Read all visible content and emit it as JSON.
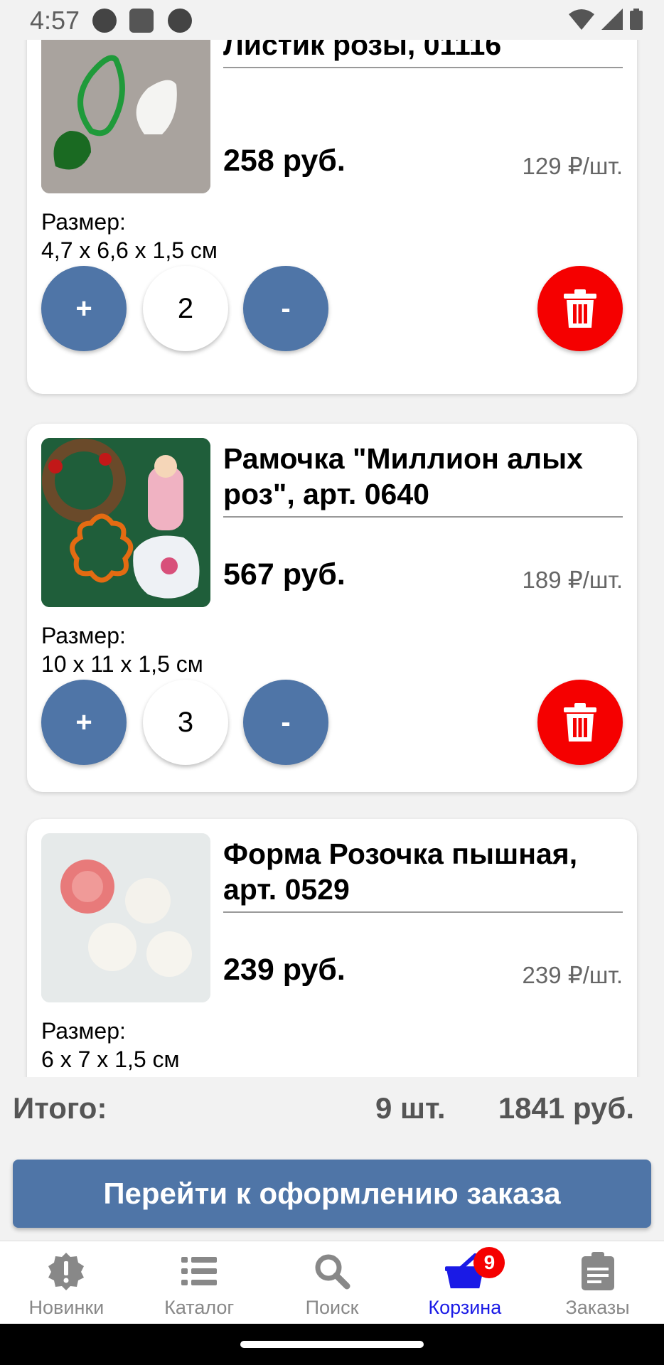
{
  "status_bar": {
    "time": "4:57"
  },
  "cart_items": [
    {
      "title": "Листик розы, 01116",
      "price": "258 руб.",
      "unit_price": "129 ₽/шт.",
      "size_label": "Размер:",
      "size": "4,7 x 6,6 x 1,5 см",
      "quantity": "2"
    },
    {
      "title": "Рамочка \"Миллион алых роз\", арт. 0640",
      "price": "567 руб.",
      "unit_price": "189 ₽/шт.",
      "size_label": "Размер:",
      "size": "10 x 11 x 1,5 см",
      "quantity": "3"
    },
    {
      "title": "Форма Розочка пышная, арт. 0529",
      "price": "239 руб.",
      "unit_price": "239 ₽/шт.",
      "size_label": "Размер:",
      "size": "6 x 7 x 1,5 см",
      "quantity": ""
    }
  ],
  "controls": {
    "plus": "+",
    "minus": "-"
  },
  "total": {
    "label": "Итого:",
    "count": "9 шт.",
    "sum": "1841 руб."
  },
  "checkout_label": "Перейти к оформлению заказа",
  "bottom_nav": {
    "items": [
      {
        "label": "Новинки",
        "icon": "alert-badge-icon"
      },
      {
        "label": "Каталог",
        "icon": "list-icon"
      },
      {
        "label": "Поиск",
        "icon": "search-icon"
      },
      {
        "label": "Корзина",
        "icon": "basket-icon",
        "badge": "9",
        "active": true
      },
      {
        "label": "Заказы",
        "icon": "clipboard-icon"
      }
    ]
  },
  "colors": {
    "accent": "#4f75a7",
    "delete": "#f50000",
    "active_nav": "#1a1ae6"
  }
}
